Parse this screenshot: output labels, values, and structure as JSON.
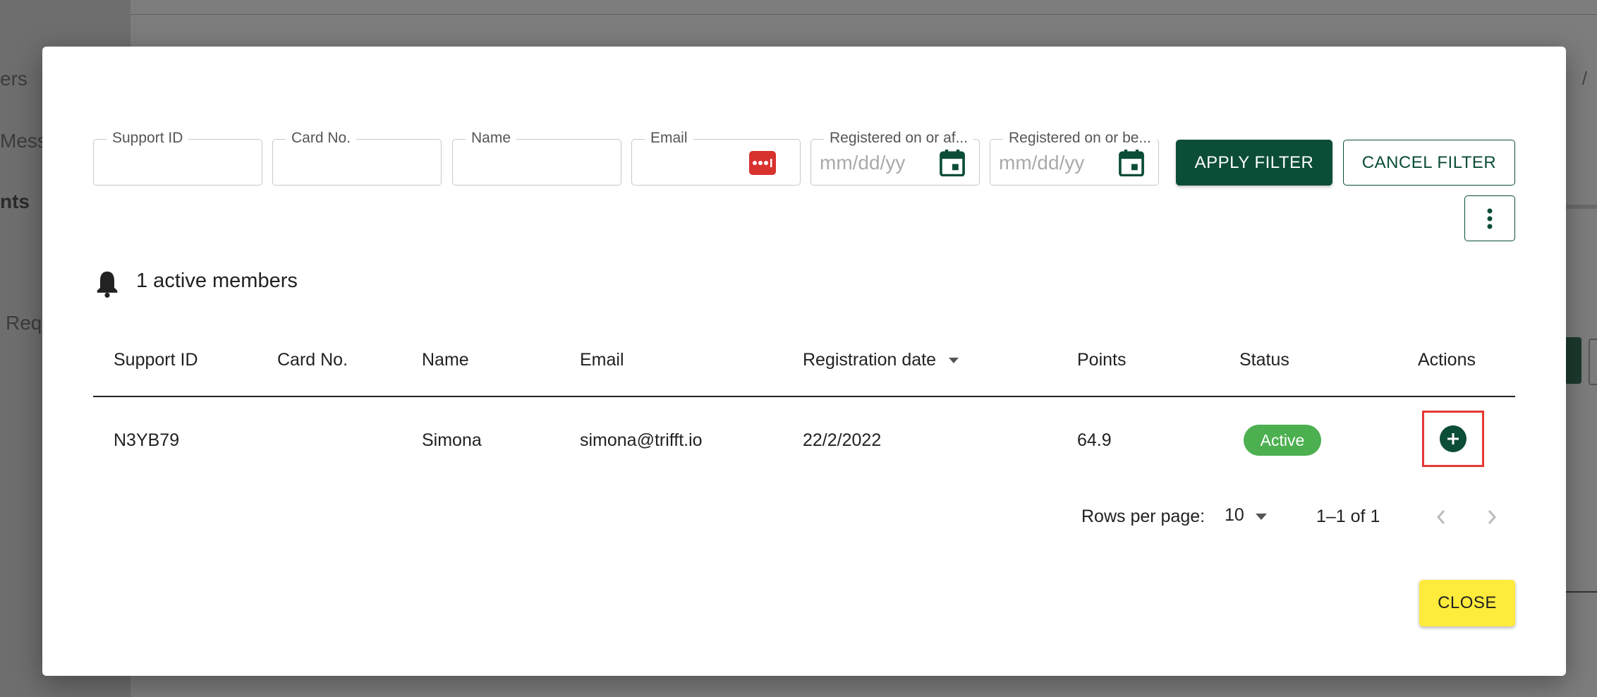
{
  "background": {
    "nav_items": [
      "ers",
      "Mess",
      "nts",
      "Req"
    ],
    "breadcrumb_sep": "/"
  },
  "filters": {
    "support_id_label": "Support ID",
    "card_no_label": "Card No.",
    "name_label": "Name",
    "email_label": "Email",
    "registered_after_label": "Registered on or af...",
    "registered_before_label": "Registered on or be...",
    "date_placeholder": "mm/dd/yy",
    "apply_label": "APPLY FILTER",
    "cancel_label": "CANCEL FILTER"
  },
  "summary": {
    "active_members_text": "1 active members"
  },
  "table": {
    "headers": {
      "support_id": "Support ID",
      "card_no": "Card No.",
      "name": "Name",
      "email": "Email",
      "registration_date": "Registration date",
      "points": "Points",
      "status": "Status",
      "actions": "Actions"
    },
    "rows": [
      {
        "support_id": "N3YB79",
        "card_no": "",
        "name": "Simona",
        "email": "simona@trifft.io",
        "registration_date": "22/2/2022",
        "points": "64.9",
        "status": "Active"
      }
    ]
  },
  "pagination": {
    "rows_per_page_label": "Rows per page:",
    "rows_per_page_value": "10",
    "range": "1–1 of 1"
  },
  "close_label": "CLOSE",
  "colors": {
    "primary": "#0b4d36",
    "status_active": "#4caf50",
    "close": "#ffeb3b",
    "highlight": "#e53935"
  }
}
